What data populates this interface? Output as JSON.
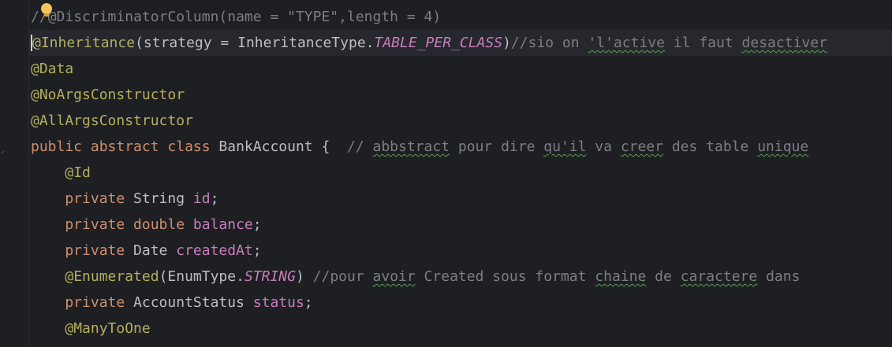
{
  "editor": {
    "lines": [
      {
        "tokens": [
          {
            "t": "//",
            "c": "comment"
          },
          {
            "t": "@DiscriminatorColumn(name = \"TYPE\",length = 4)",
            "c": "comment"
          }
        ]
      },
      {
        "current": true,
        "tokens": [
          {
            "t": "@",
            "c": "annotation",
            "caret": true
          },
          {
            "t": "Inheritance",
            "c": "annotation"
          },
          {
            "t": "(strategy = InheritanceType.",
            "c": "plain"
          },
          {
            "t": "TABLE_PER_CLASS",
            "c": "const"
          },
          {
            "t": ")",
            "c": "plain"
          },
          {
            "t": "//sio on ",
            "c": "comment"
          },
          {
            "t": "'l'active",
            "c": "comment",
            "typo": true
          },
          {
            "t": " il faut ",
            "c": "comment"
          },
          {
            "t": "desactiver",
            "c": "comment",
            "typo": true
          }
        ]
      },
      {
        "tokens": [
          {
            "t": "@Data",
            "c": "annotation"
          }
        ]
      },
      {
        "tokens": [
          {
            "t": "@NoArgsConstructor",
            "c": "annotation"
          }
        ]
      },
      {
        "tokens": [
          {
            "t": "@AllArgsConstructor",
            "c": "annotation"
          }
        ]
      },
      {
        "tokens": [
          {
            "t": "public abstract class ",
            "c": "keyword"
          },
          {
            "t": "BankAccount {  ",
            "c": "plain"
          },
          {
            "t": "// ",
            "c": "comment"
          },
          {
            "t": "abbstract",
            "c": "comment",
            "typo": true
          },
          {
            "t": " pour dire ",
            "c": "comment"
          },
          {
            "t": "qu'il",
            "c": "comment",
            "typo": true
          },
          {
            "t": " va ",
            "c": "comment"
          },
          {
            "t": "creer",
            "c": "comment",
            "typo": true
          },
          {
            "t": " des table ",
            "c": "comment"
          },
          {
            "t": "unique",
            "c": "comment",
            "typo": true
          }
        ]
      },
      {
        "tokens": [
          {
            "t": "    ",
            "c": "plain"
          },
          {
            "t": "@Id",
            "c": "annotation"
          }
        ]
      },
      {
        "tokens": [
          {
            "t": "    private ",
            "c": "keyword"
          },
          {
            "t": "String ",
            "c": "plain"
          },
          {
            "t": "id",
            "c": "field"
          },
          {
            "t": ";",
            "c": "plain"
          }
        ]
      },
      {
        "tokens": [
          {
            "t": "    private double ",
            "c": "keyword"
          },
          {
            "t": "balance",
            "c": "field"
          },
          {
            "t": ";",
            "c": "plain"
          }
        ]
      },
      {
        "tokens": [
          {
            "t": "    private ",
            "c": "keyword"
          },
          {
            "t": "Date ",
            "c": "plain"
          },
          {
            "t": "createdAt",
            "c": "field"
          },
          {
            "t": ";",
            "c": "plain"
          }
        ]
      },
      {
        "tokens": [
          {
            "t": "    ",
            "c": "plain"
          },
          {
            "t": "@Enumerated",
            "c": "annotation"
          },
          {
            "t": "(EnumType.",
            "c": "plain"
          },
          {
            "t": "STRING",
            "c": "const"
          },
          {
            "t": ") ",
            "c": "plain"
          },
          {
            "t": "//pour ",
            "c": "comment"
          },
          {
            "t": "avoir",
            "c": "comment",
            "typo": true
          },
          {
            "t": " Created sous format ",
            "c": "comment"
          },
          {
            "t": "chaine",
            "c": "comment",
            "typo": true
          },
          {
            "t": " de ",
            "c": "comment"
          },
          {
            "t": "caractere",
            "c": "comment",
            "typo": true
          },
          {
            "t": " dans",
            "c": "comment"
          }
        ]
      },
      {
        "tokens": [
          {
            "t": "    private ",
            "c": "keyword"
          },
          {
            "t": "AccountStatus ",
            "c": "plain"
          },
          {
            "t": "status",
            "c": "field"
          },
          {
            "t": ";",
            "c": "plain"
          }
        ]
      },
      {
        "tokens": [
          {
            "t": "    ",
            "c": "plain"
          },
          {
            "t": "@ManyToOne",
            "c": "annotation"
          }
        ]
      }
    ]
  },
  "gutter": {
    "mark": "ˏ"
  },
  "icons": {
    "intention": "lightbulb-icon"
  }
}
